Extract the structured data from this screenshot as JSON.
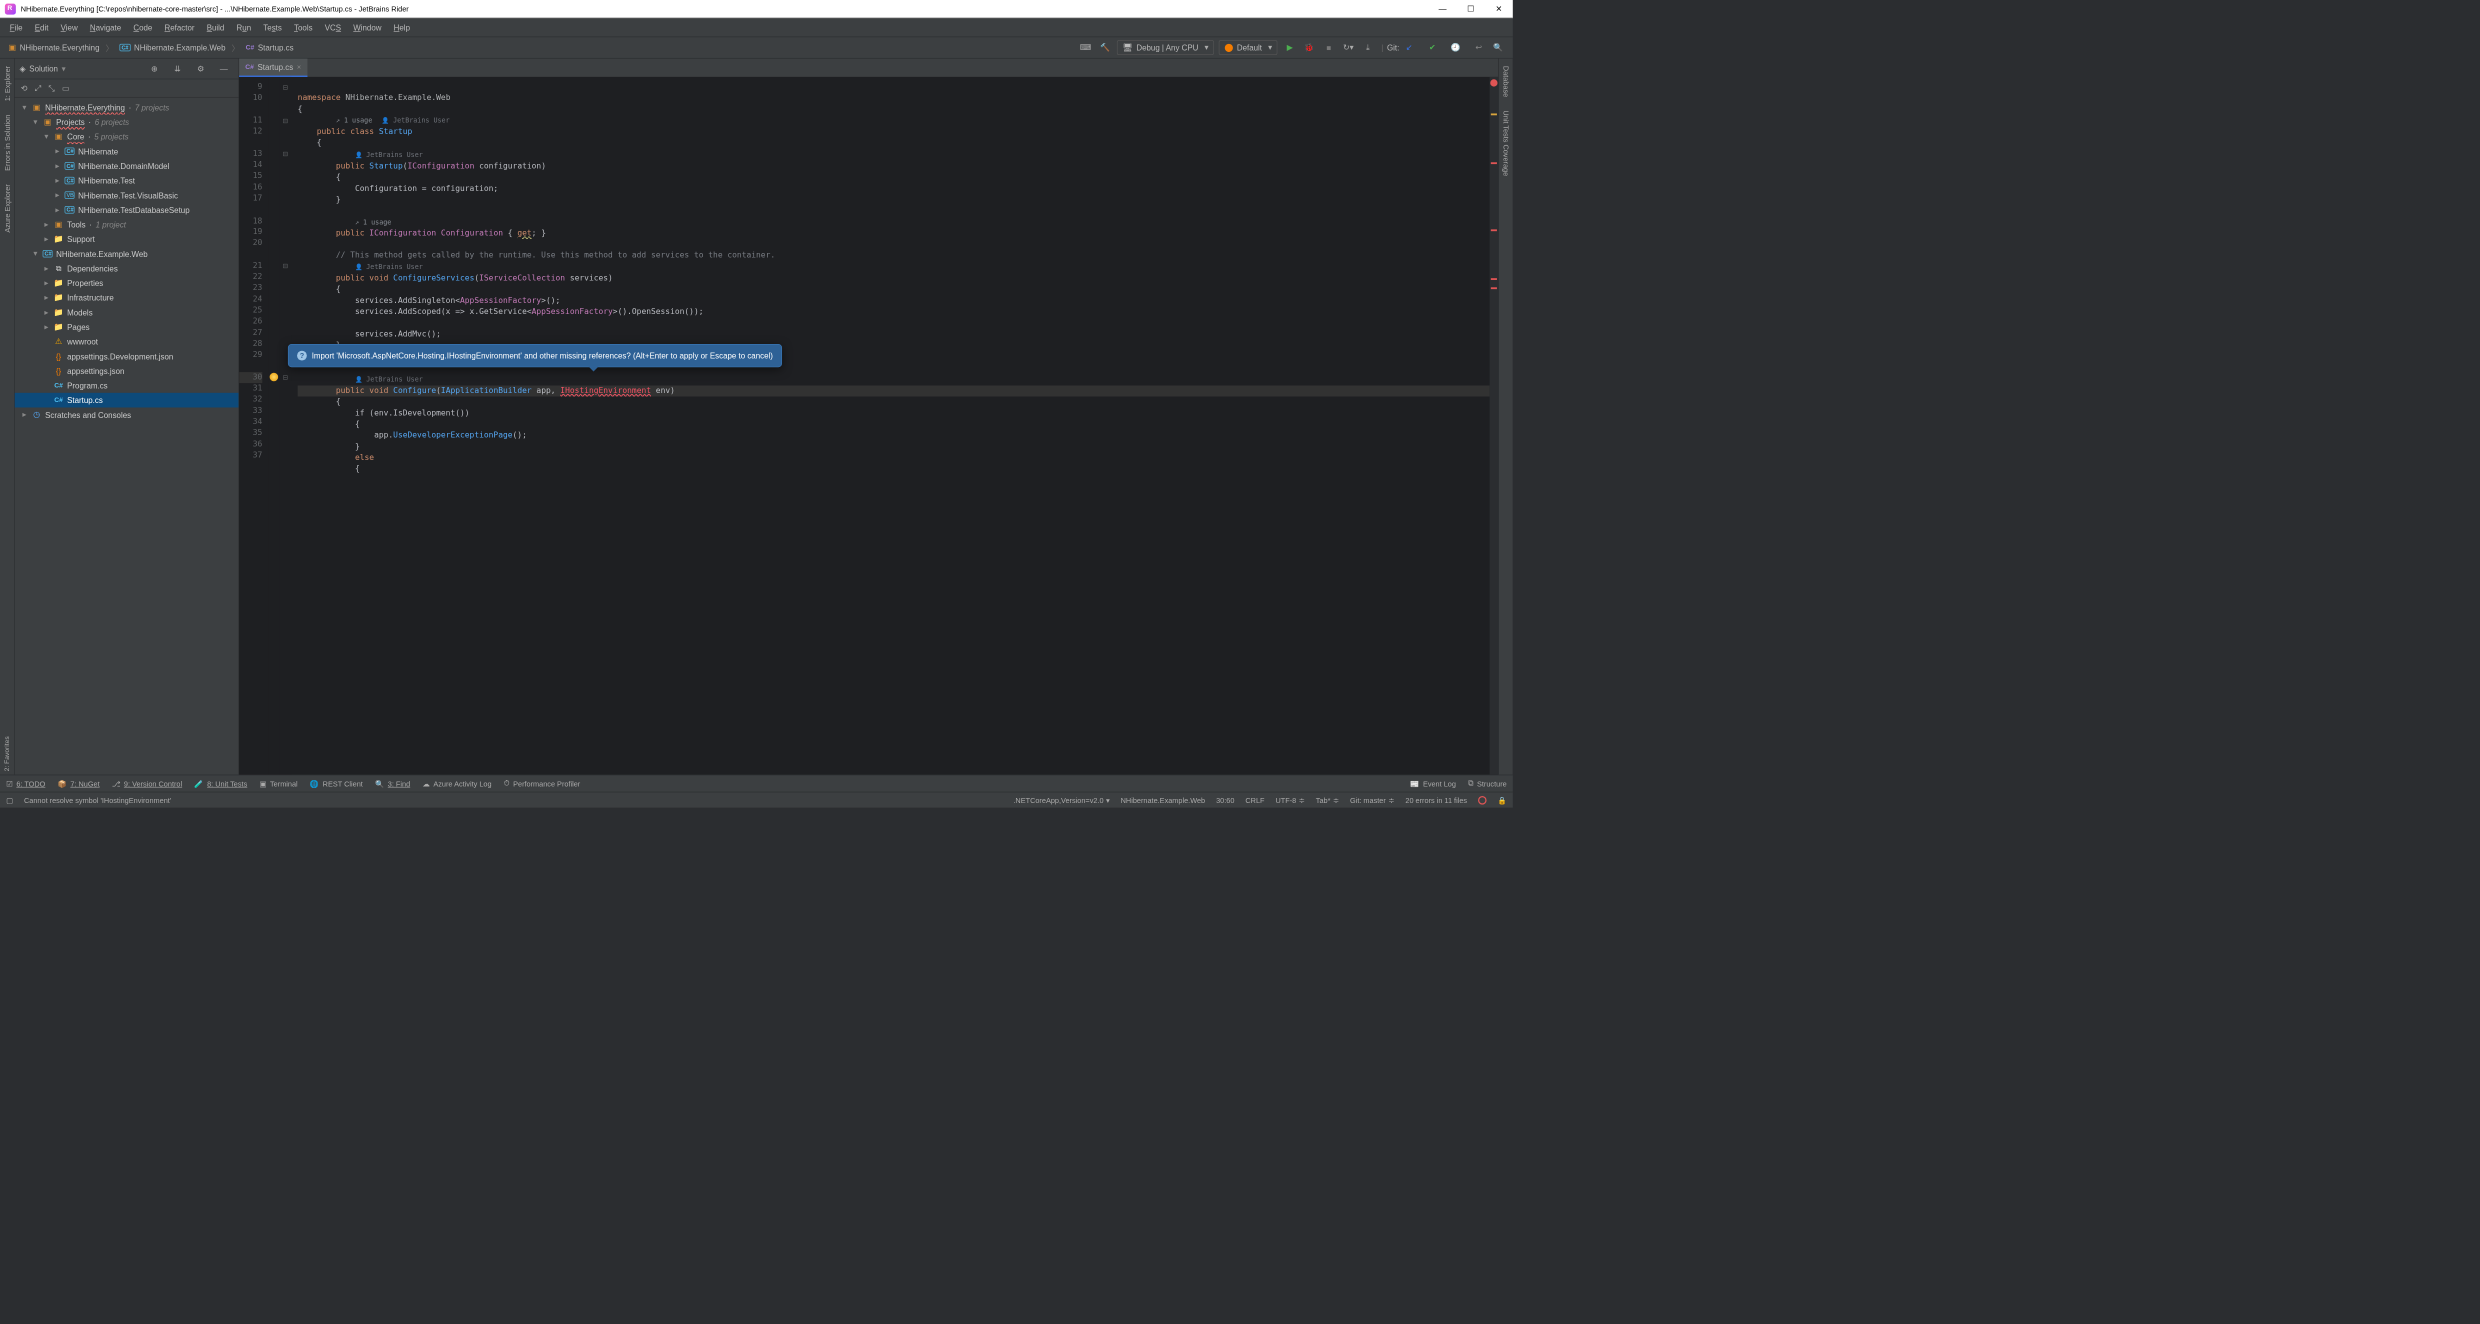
{
  "title": "NHibernate.Everything [C:\\repos\\nhibernate-core-master\\src] - ...\\NHibernate.Example.Web\\Startup.cs - JetBrains Rider",
  "menu": [
    "File",
    "Edit",
    "View",
    "Navigate",
    "Code",
    "Refactor",
    "Build",
    "Run",
    "Tests",
    "Tools",
    "VCS",
    "Window",
    "Help"
  ],
  "breadcrumb": {
    "solution": "NHibernate.Everything",
    "project": "NHibernate.Example.Web",
    "file_prefix": "C#",
    "file": "Startup.cs"
  },
  "run_config": "Debug | Any CPU",
  "launch_config": "Default",
  "git_label": "Git:",
  "solution_header": "Solution",
  "file_tab": {
    "prefix": "C#",
    "name": "Startup.cs"
  },
  "left_tabs": [
    "1: Explorer",
    "Errors in Solution",
    "Azure Explorer",
    "2: Favorites"
  ],
  "right_tabs": [
    "Database",
    "Unit Tests Coverage"
  ],
  "tree": {
    "root": {
      "name": "NHibernate.Everything",
      "note": "7 projects"
    },
    "projects": {
      "name": "Projects",
      "note": "6 projects"
    },
    "core": {
      "name": "Core",
      "note": "5 projects"
    },
    "nhibernate": "NHibernate",
    "nhibernate_domain": "NHibernate.DomainModel",
    "nhibernate_test": "NHibernate.Test",
    "nhibernate_vb": "NHibernate.Test.VisualBasic",
    "nhibernate_db": "NHibernate.TestDatabaseSetup",
    "tools": {
      "name": "Tools",
      "note": "1 project"
    },
    "support": "Support",
    "example_web": "NHibernate.Example.Web",
    "dependencies": "Dependencies",
    "properties": "Properties",
    "infrastructure": "Infrastructure",
    "models": "Models",
    "pages": "Pages",
    "wwwroot": "wwwroot",
    "appsettings_dev": "appsettings.Development.json",
    "appsettings": "appsettings.json",
    "program": "Program.cs",
    "startup": "Startup.cs",
    "scratches": "Scratches and Consoles"
  },
  "code": {
    "namespace_kw": "namespace",
    "namespace": "NHibernate.Example.Web",
    "usage1": "1 usage",
    "user": "JetBrains User",
    "public": "public",
    "class": "class",
    "startup": "Startup",
    "iconfig": "IConfiguration",
    "configuration_param": "configuration",
    "config_assign": "Configuration = configuration;",
    "get": "get",
    "comment_services": "// This method gets called by the runtime. Use this method to add services to the container.",
    "void": "void",
    "config_services": "ConfigureServices",
    "iservicecoll": "IServiceCollection",
    "services": "services",
    "line23": "services.AddSingleton<",
    "appsession": "AppSessionFactory",
    "line23b": ">();",
    "line24a": "services.AddScoped(x => x.GetService<",
    "line24b": ">().OpenSession());",
    "line26": "services.AddMvc();",
    "configure": "Configure",
    "iappbuilder": "IApplicationBuilder",
    "app": "app",
    "ihosting": "IHostingEnvironment",
    "env": "env",
    "isdev": "if (env.IsDevelopment())",
    "usedev": "app.",
    "usedevmethod": "UseDeveloperExceptionPage",
    "usedev_end": "();",
    "else": "else"
  },
  "popup": "Import 'Microsoft.AspNetCore.Hosting.IHostingEnvironment' and other missing references? (Alt+Enter to apply or Escape to cancel)",
  "line_numbers": [
    9,
    10,
    "",
    11,
    12,
    "",
    13,
    14,
    15,
    16,
    17,
    "",
    18,
    19,
    20,
    "",
    21,
    22,
    23,
    24,
    25,
    26,
    27,
    28,
    29,
    "",
    30,
    31,
    32,
    33,
    34,
    35,
    36,
    37
  ],
  "bottom": {
    "todo": "6: TODO",
    "nuget": "7: NuGet",
    "vcs": "9: Version Control",
    "unit": "8: Unit Tests",
    "terminal": "Terminal",
    "rest": "REST Client",
    "find": "3: Find",
    "azure": "Azure Activity Log",
    "perf": "Performance Profiler",
    "eventlog": "Event Log",
    "structure": "Structure"
  },
  "status": {
    "msg": "Cannot resolve symbol 'IHostingEnvironment'",
    "target": ".NETCoreApp,Version=v2.0",
    "context": "NHibernate.Example.Web",
    "pos": "30:60",
    "crlf": "CRLF",
    "enc": "UTF-8",
    "tab": "Tab*",
    "branch": "Git: master",
    "errors": "20 errors in 11 files"
  }
}
